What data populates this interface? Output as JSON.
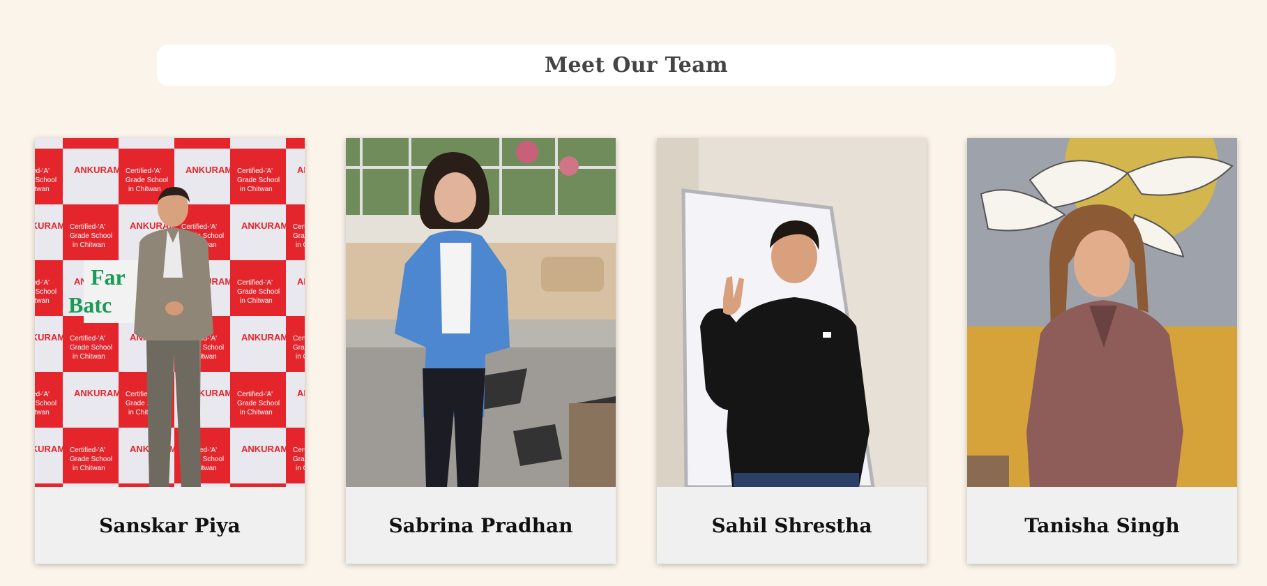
{
  "header": {
    "title": "Meet Our Team"
  },
  "team": [
    {
      "name": "Sanskar Piya",
      "photo": "photo-sanskar"
    },
    {
      "name": "Sabrina Pradhan",
      "photo": "photo-sabrina"
    },
    {
      "name": "Sahil Shrestha",
      "photo": "photo-sahil"
    },
    {
      "name": "Tanisha Singh",
      "photo": "photo-tanisha"
    }
  ],
  "colors": {
    "background": "#fbf4ea",
    "title_box": "#ffffff",
    "title_text": "#444444",
    "card_footer": "#f0f0f0",
    "name_text": "#111111"
  }
}
